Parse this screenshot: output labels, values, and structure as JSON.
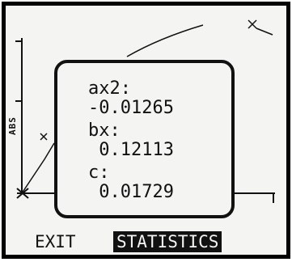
{
  "plot": {
    "y_axis_label": "ABS"
  },
  "popup": {
    "coefficients": [
      {
        "label": "ax2:",
        "value": "-0.01265"
      },
      {
        "label": "bx:",
        "value": " 0.12113"
      },
      {
        "label": "c:",
        "value": " 0.01729"
      }
    ]
  },
  "softkeys": {
    "exit_label": "EXIT",
    "statistics_label": "STATISTICS"
  },
  "colors": {
    "lcd_background": "#f4f4f2",
    "ink": "#111111"
  }
}
